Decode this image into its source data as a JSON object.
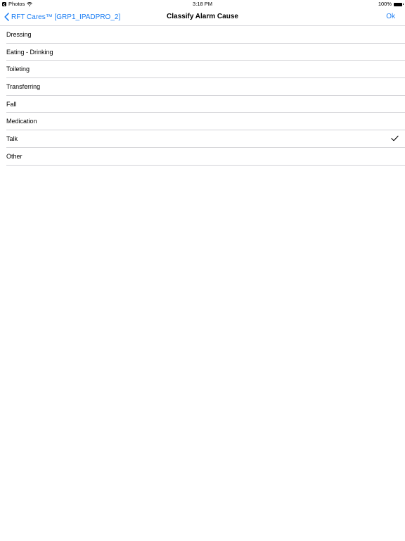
{
  "status_bar": {
    "back_app": "Photos",
    "time": "3:18 PM",
    "battery_percent": "100%",
    "icons": [
      "back-app-icon",
      "wifi-icon",
      "battery-icon"
    ]
  },
  "nav_bar": {
    "back_label": "RFT Cares™ [GRP1_IPADPRO_2]",
    "title": "Classify Alarm Cause",
    "ok_label": "Ok",
    "accent_color": "#1a7df4"
  },
  "list": {
    "items": [
      {
        "label": "Dressing",
        "selected": false
      },
      {
        "label": "Eating - Drinking",
        "selected": false
      },
      {
        "label": "Toileting",
        "selected": false
      },
      {
        "label": "Transferring",
        "selected": false
      },
      {
        "label": "Fall",
        "selected": false
      },
      {
        "label": "Medication",
        "selected": false
      },
      {
        "label": "Talk",
        "selected": true
      },
      {
        "label": "Other",
        "selected": false
      }
    ]
  }
}
